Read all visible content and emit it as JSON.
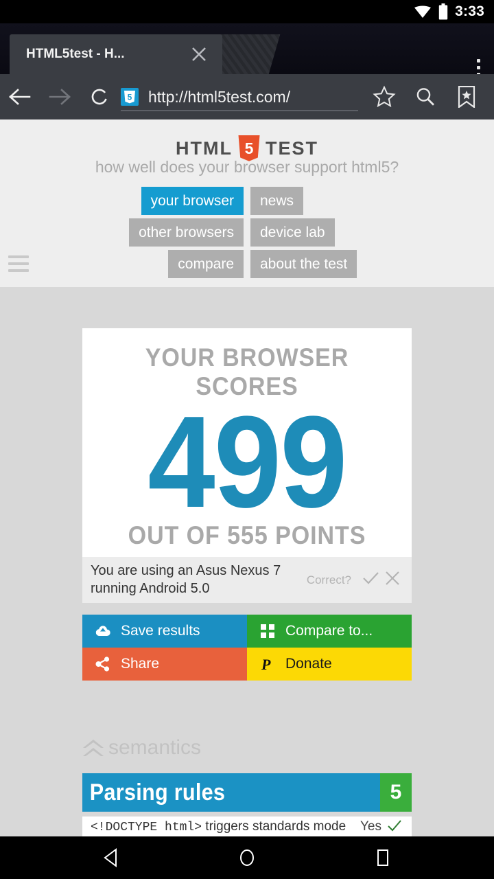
{
  "status_bar": {
    "clock": "3:33",
    "icons": [
      "wifi-icon",
      "battery-icon"
    ]
  },
  "browser": {
    "tab": {
      "title": "HTML5test - H...",
      "close_label": "close-tab"
    },
    "new_tab_label": "+",
    "menu_label": "overflow-menu",
    "url": "http://html5test.com/",
    "favicon": "html5-shield-favicon",
    "back_label": "Back",
    "forward_label": "Forward",
    "reload_label": "Reload",
    "bookmark_star_label": "Bookmark",
    "search_label": "Search",
    "bookmarks_label": "Bookmarks"
  },
  "site": {
    "logo": {
      "left": "HTML",
      "shield": "5",
      "right": "TEST"
    },
    "tagline": "how well does your browser support html5?",
    "menu_icon": "hamburger-icon",
    "nav": [
      {
        "label": "your browser",
        "active": true
      },
      {
        "label": "news",
        "active": false
      },
      {
        "label": "other browsers",
        "active": false
      },
      {
        "label": "device lab",
        "active": false
      },
      {
        "label": "compare",
        "active": false
      },
      {
        "label": "about the test",
        "active": false
      }
    ]
  },
  "score_card": {
    "headline": "YOUR BROWSER SCORES",
    "score": "499",
    "subline": "OUT OF 555 POINTS"
  },
  "device_bar": {
    "text": "You are using an Asus Nexus 7 running Android 5.0",
    "correct_label": "Correct?",
    "confirm_icon": "check-icon",
    "reject_icon": "cross-icon"
  },
  "actions": [
    {
      "label": "Save results",
      "icon": "cloud-upload-icon",
      "color": "#1b8fc2"
    },
    {
      "label": "Compare to...",
      "icon": "grid-icon",
      "color": "#2aa332"
    },
    {
      "label": "Share",
      "icon": "share-icon",
      "color": "#e8613c"
    },
    {
      "label": "Donate",
      "icon": "paypal-icon",
      "color": "#fcd905"
    }
  ],
  "section": {
    "title": "semantics",
    "icon": "double-chevron-up-icon",
    "bar": {
      "label": "Parsing rules",
      "score": "5"
    },
    "feature": {
      "name_code": "<!DOCTYPE html>",
      "name_rest": " triggers standards mode",
      "value": "Yes",
      "icon": "check-icon"
    }
  },
  "nav_bar": {
    "back": "back-triangle-icon",
    "home": "home-circle-icon",
    "recents": "recents-square-icon"
  },
  "colors": {
    "accent_blue": "#1e8cb8",
    "nav_active": "#159cd0",
    "bar_blue": "#1b92c4",
    "badge_green": "#3aae3c",
    "page_bg": "#d8d8d8",
    "header_bg": "#eeeeee"
  }
}
